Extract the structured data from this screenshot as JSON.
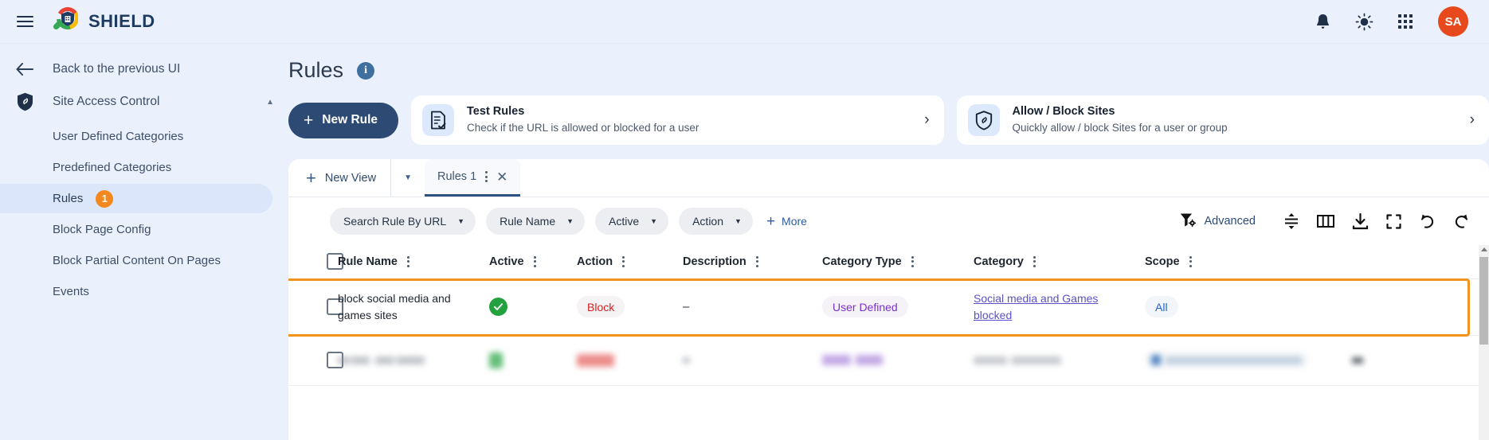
{
  "topbar": {
    "brand": "SHIELD",
    "menu_icon": "hamburger-icon",
    "logo_icon": "shield-magnifier-logo",
    "notifications_icon": "bell-icon",
    "theme_icon": "sun-icon",
    "apps_icon": "grid-apps-icon",
    "avatar_initials": "SA",
    "avatar_color": "#e8491c"
  },
  "sidebar": {
    "back_label": "Back to the previous UI",
    "back_icon": "arrow-left-icon",
    "group": {
      "label": "Site Access Control",
      "icon": "shield-icon",
      "caret": "▲"
    },
    "items": [
      {
        "label": "User Defined Categories",
        "active": false,
        "badge": ""
      },
      {
        "label": "Predefined Categories",
        "active": false,
        "badge": ""
      },
      {
        "label": "Rules",
        "active": true,
        "badge": "1"
      },
      {
        "label": "Block Page Config",
        "active": false,
        "badge": ""
      },
      {
        "label": "Block Partial Content On Pages",
        "active": false,
        "badge": ""
      },
      {
        "label": "Events",
        "active": false,
        "badge": ""
      }
    ]
  },
  "page": {
    "title": "Rules",
    "info_icon": "info-icon",
    "new_rule_label": "New Rule",
    "cards": [
      {
        "title": "Test Rules",
        "subtitle": "Check if the URL is allowed or blocked for a user",
        "icon": "document-check-icon",
        "chevron": "›"
      },
      {
        "title": "Allow / Block Sites",
        "subtitle": "Quickly allow / block Sites for a user or group",
        "icon": "shield-link-icon",
        "chevron": "›"
      }
    ]
  },
  "tabs": {
    "new_view_label": "New View",
    "new_view_icon": "plus-icon",
    "dropdown_icon": "chevron-down-icon",
    "items": [
      {
        "label": "Rules 1",
        "active": true,
        "kebab_icon": "kebab-menu-icon",
        "close_icon": "close-icon"
      }
    ]
  },
  "filters": {
    "chips": [
      {
        "label": "Search Rule By URL",
        "caret": "▼"
      },
      {
        "label": "Rule Name",
        "caret": "▼"
      },
      {
        "label": "Active",
        "caret": "▼"
      },
      {
        "label": "Action",
        "caret": "▼"
      }
    ],
    "more_label": "More",
    "more_icon": "plus-icon",
    "advanced_label": "Advanced",
    "advanced_icon": "filter-settings-icon",
    "tools": [
      {
        "icon": "row-height-icon",
        "name": "row-height-button"
      },
      {
        "icon": "columns-icon",
        "name": "columns-button"
      },
      {
        "icon": "download-icon",
        "name": "download-button"
      },
      {
        "icon": "fullscreen-icon",
        "name": "fullscreen-button"
      },
      {
        "icon": "undo-icon",
        "name": "undo-button"
      },
      {
        "icon": "refresh-icon",
        "name": "refresh-button"
      }
    ]
  },
  "table": {
    "select_all_icon": "checkbox-unchecked",
    "columns": [
      {
        "label": "Rule Name"
      },
      {
        "label": "Active"
      },
      {
        "label": "Action"
      },
      {
        "label": "Description"
      },
      {
        "label": "Category Type"
      },
      {
        "label": "Category"
      },
      {
        "label": "Scope"
      }
    ],
    "rows": [
      {
        "highlighted": true,
        "blurred": false,
        "rule_name": "block social media and games sites",
        "active": "✓",
        "action": "Block",
        "description": "–",
        "category_type": "User Defined",
        "category": "Social media and Games blocked",
        "scope": "All"
      },
      {
        "highlighted": false,
        "blurred": true,
        "rule_name": "",
        "active": "",
        "action": "",
        "description": "",
        "category_type": "",
        "category": "",
        "scope": ""
      }
    ]
  },
  "colors": {
    "accent_highlight": "#f2921f",
    "brand_dark": "#2c4a73",
    "badge_block": "#d61f1f",
    "badge_userdefined": "#7b2fd0",
    "badge_all": "#1f66d0",
    "link": "#5a51c9",
    "active_check": "#23a13f",
    "sidebar_bg": "#eaf1fd"
  }
}
